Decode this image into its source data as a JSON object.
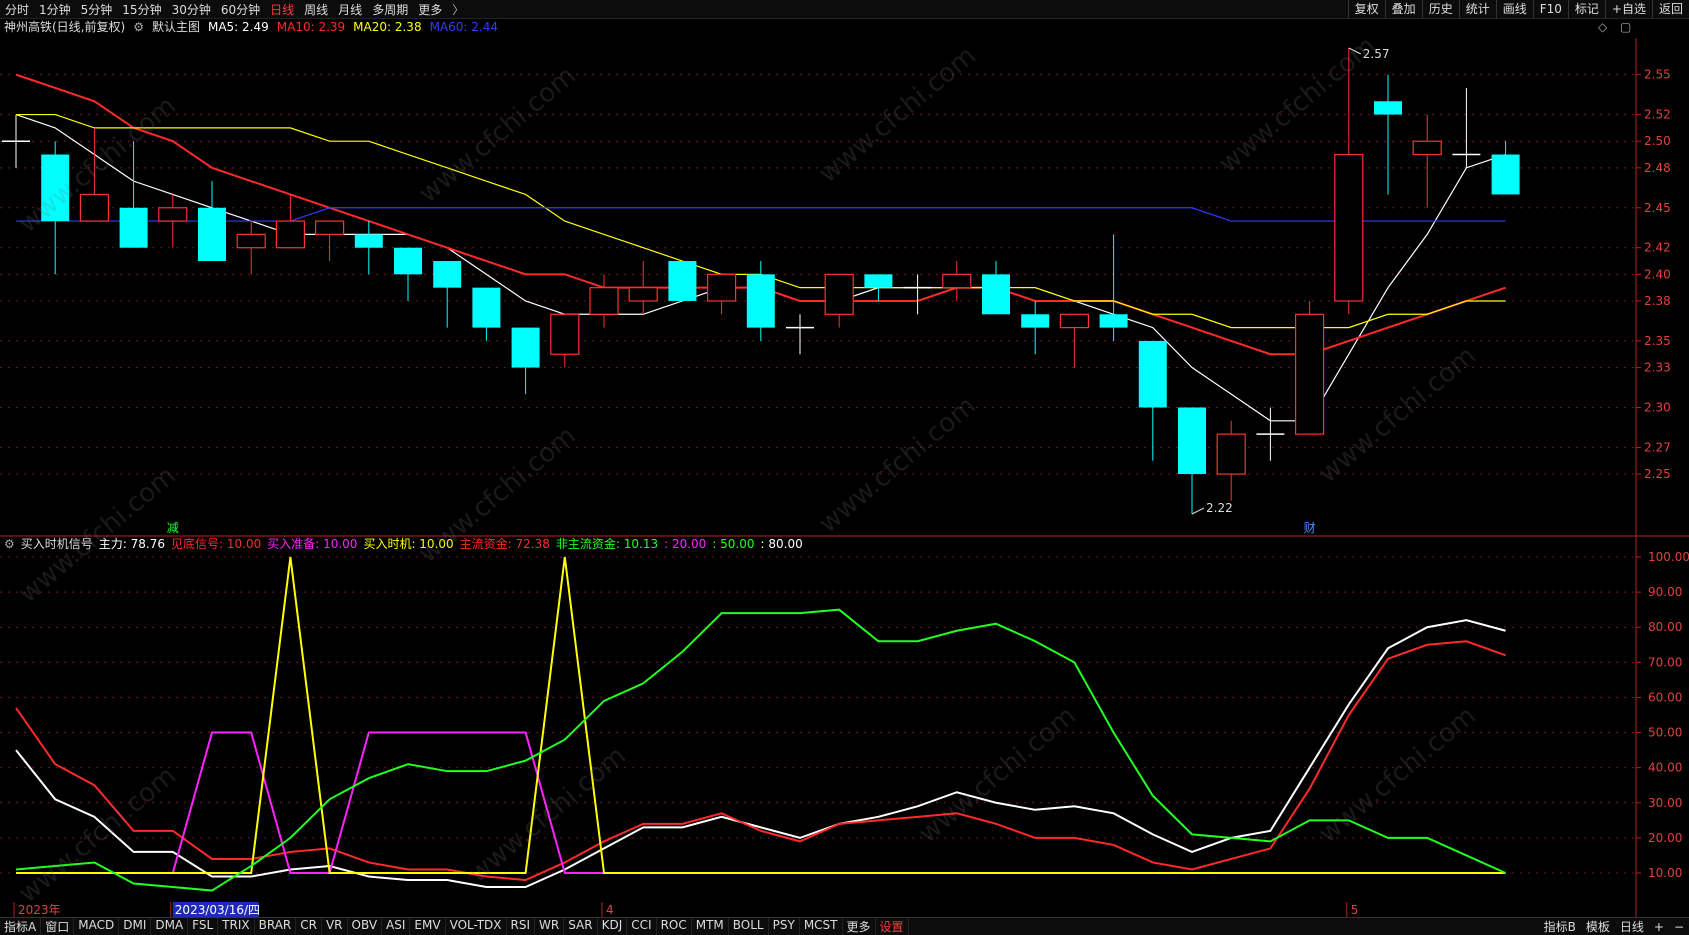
{
  "toolbar": {
    "timeframes": [
      "分时",
      "1分钟",
      "5分钟",
      "15分钟",
      "30分钟",
      "60分钟",
      "日线",
      "周线",
      "月线",
      "多周期",
      "更多"
    ],
    "active_timeframe": "日线",
    "more_arrow": "〉",
    "right_buttons": [
      "复权",
      "叠加",
      "历史",
      "统计",
      "画线",
      "F10",
      "标记",
      "+自选",
      "返回"
    ]
  },
  "main_header": {
    "stock": "神州高铁(日线,前复权)",
    "template_icon": "gear-icon",
    "template": "默认主图",
    "ma_labels": [
      {
        "text": "MA5: 2.49",
        "color": "#ffffff"
      },
      {
        "text": "MA10: 2.39",
        "color": "#ff2a2a"
      },
      {
        "text": "MA20: 2.38",
        "color": "#ffff00"
      },
      {
        "text": "MA60: 2.44",
        "color": "#2f3cff"
      }
    ],
    "diamond_icon": "◇",
    "square_icon": "▢"
  },
  "sub_header": {
    "indicator": "买入时机信号",
    "labels": [
      {
        "text": "主力: 78.76",
        "color": "#ffffff"
      },
      {
        "text": "见底信号: 10.00",
        "color": "#ff2a2a"
      },
      {
        "text": "买入准备: 10.00",
        "color": "#ff22ff"
      },
      {
        "text": "买入时机: 10.00",
        "color": "#ffff00"
      },
      {
        "text": "主流资金: 72.38",
        "color": "#ff2a2a"
      },
      {
        "text": "非主流资金: 10.13",
        "color": "#22ff22"
      },
      {
        "text": ": 20.00",
        "color": "#ff22ff"
      },
      {
        "text": ": 50.00",
        "color": "#22ff22"
      },
      {
        "text": ": 80.00",
        "color": "#ffffff"
      }
    ]
  },
  "bottom_tabs": [
    "指标A",
    "窗口",
    "MACD",
    "DMI",
    "DMA",
    "FSL",
    "TRIX",
    "BRAR",
    "CR",
    "VR",
    "OBV",
    "ASI",
    "EMV",
    "VOL-TDX",
    "RSI",
    "WR",
    "SAR",
    "KDJ",
    "CCI",
    "ROC",
    "MTM",
    "BOLL",
    "PSY",
    "MCST",
    "更多",
    "设置"
  ],
  "bottom_active": "设置",
  "bottom_right": [
    "指标B",
    "模板",
    "日线",
    "+",
    "−"
  ],
  "watermark": "www.cfchi.com",
  "chart_data": [
    {
      "type": "candlestick",
      "name": "main",
      "ylim": [
        2.22,
        2.57
      ],
      "y_ticks": [
        2.25,
        2.27,
        2.3,
        2.33,
        2.35,
        2.38,
        2.4,
        2.42,
        2.45,
        2.48,
        2.5,
        2.52,
        2.55
      ],
      "candles": [
        {
          "o": 2.5,
          "c": 2.5,
          "h": 2.52,
          "l": 2.48
        },
        {
          "o": 2.49,
          "c": 2.44,
          "h": 2.5,
          "l": 2.4
        },
        {
          "o": 2.44,
          "c": 2.46,
          "h": 2.51,
          "l": 2.44
        },
        {
          "o": 2.45,
          "c": 2.42,
          "h": 2.5,
          "l": 2.42
        },
        {
          "o": 2.44,
          "c": 2.45,
          "h": 2.46,
          "l": 2.42
        },
        {
          "o": 2.45,
          "c": 2.41,
          "h": 2.47,
          "l": 2.41
        },
        {
          "o": 2.42,
          "c": 2.43,
          "h": 2.44,
          "l": 2.4
        },
        {
          "o": 2.42,
          "c": 2.44,
          "h": 2.46,
          "l": 2.42
        },
        {
          "o": 2.43,
          "c": 2.44,
          "h": 2.44,
          "l": 2.41
        },
        {
          "o": 2.43,
          "c": 2.42,
          "h": 2.44,
          "l": 2.4
        },
        {
          "o": 2.42,
          "c": 2.4,
          "h": 2.42,
          "l": 2.38
        },
        {
          "o": 2.41,
          "c": 2.39,
          "h": 2.41,
          "l": 2.36
        },
        {
          "o": 2.39,
          "c": 2.36,
          "h": 2.39,
          "l": 2.35
        },
        {
          "o": 2.36,
          "c": 2.33,
          "h": 2.36,
          "l": 2.31
        },
        {
          "o": 2.34,
          "c": 2.37,
          "h": 2.37,
          "l": 2.33
        },
        {
          "o": 2.37,
          "c": 2.39,
          "h": 2.4,
          "l": 2.36
        },
        {
          "o": 2.38,
          "c": 2.39,
          "h": 2.41,
          "l": 2.37
        },
        {
          "o": 2.41,
          "c": 2.38,
          "h": 2.41,
          "l": 2.38
        },
        {
          "o": 2.38,
          "c": 2.4,
          "h": 2.4,
          "l": 2.37
        },
        {
          "o": 2.4,
          "c": 2.36,
          "h": 2.41,
          "l": 2.35
        },
        {
          "o": 2.36,
          "c": 2.36,
          "h": 2.37,
          "l": 2.34
        },
        {
          "o": 2.37,
          "c": 2.4,
          "h": 2.4,
          "l": 2.36
        },
        {
          "o": 2.4,
          "c": 2.39,
          "h": 2.4,
          "l": 2.38
        },
        {
          "o": 2.39,
          "c": 2.39,
          "h": 2.4,
          "l": 2.37
        },
        {
          "o": 2.39,
          "c": 2.4,
          "h": 2.41,
          "l": 2.38
        },
        {
          "o": 2.4,
          "c": 2.37,
          "h": 2.41,
          "l": 2.37
        },
        {
          "o": 2.37,
          "c": 2.36,
          "h": 2.38,
          "l": 2.34
        },
        {
          "o": 2.36,
          "c": 2.37,
          "h": 2.37,
          "l": 2.33
        },
        {
          "o": 2.37,
          "c": 2.36,
          "h": 2.43,
          "l": 2.35
        },
        {
          "o": 2.35,
          "c": 2.3,
          "h": 2.35,
          "l": 2.26
        },
        {
          "o": 2.3,
          "c": 2.25,
          "h": 2.3,
          "l": 2.22
        },
        {
          "o": 2.25,
          "c": 2.28,
          "h": 2.29,
          "l": 2.23
        },
        {
          "o": 2.28,
          "c": 2.28,
          "h": 2.3,
          "l": 2.26
        },
        {
          "o": 2.28,
          "c": 2.37,
          "h": 2.38,
          "l": 2.28
        },
        {
          "o": 2.38,
          "c": 2.49,
          "h": 2.57,
          "l": 2.37
        },
        {
          "o": 2.53,
          "c": 2.52,
          "h": 2.55,
          "l": 2.46
        },
        {
          "o": 2.49,
          "c": 2.5,
          "h": 2.52,
          "l": 2.45
        },
        {
          "o": 2.49,
          "c": 2.49,
          "h": 2.54,
          "l": 2.48
        },
        {
          "o": 2.49,
          "c": 2.46,
          "h": 2.5,
          "l": 2.46
        }
      ],
      "ma_series": [
        {
          "name": "MA5",
          "color": "#ffffff",
          "values": [
            2.52,
            2.51,
            2.49,
            2.47,
            2.46,
            2.45,
            2.44,
            2.43,
            2.43,
            2.43,
            2.43,
            2.42,
            2.4,
            2.38,
            2.37,
            2.37,
            2.37,
            2.38,
            2.39,
            2.39,
            2.38,
            2.38,
            2.39,
            2.39,
            2.39,
            2.39,
            2.38,
            2.38,
            2.37,
            2.36,
            2.33,
            2.31,
            2.29,
            2.29,
            2.34,
            2.39,
            2.43,
            2.48,
            2.49
          ]
        },
        {
          "name": "MA10",
          "color": "#ff2a2a",
          "values": [
            2.55,
            2.54,
            2.53,
            2.51,
            2.5,
            2.48,
            2.47,
            2.46,
            2.45,
            2.44,
            2.43,
            2.42,
            2.41,
            2.4,
            2.4,
            2.39,
            2.39,
            2.39,
            2.39,
            2.39,
            2.38,
            2.38,
            2.38,
            2.38,
            2.39,
            2.39,
            2.38,
            2.38,
            2.38,
            2.37,
            2.36,
            2.35,
            2.34,
            2.34,
            2.35,
            2.36,
            2.37,
            2.38,
            2.39
          ]
        },
        {
          "name": "MA20",
          "color": "#ffff00",
          "values": [
            2.52,
            2.52,
            2.51,
            2.51,
            2.51,
            2.51,
            2.51,
            2.51,
            2.5,
            2.5,
            2.49,
            2.48,
            2.47,
            2.46,
            2.44,
            2.43,
            2.42,
            2.41,
            2.4,
            2.4,
            2.39,
            2.39,
            2.39,
            2.39,
            2.39,
            2.39,
            2.39,
            2.38,
            2.38,
            2.37,
            2.37,
            2.36,
            2.36,
            2.36,
            2.36,
            2.37,
            2.37,
            2.38,
            2.38
          ]
        },
        {
          "name": "MA60",
          "color": "#2f3cff",
          "values": [
            2.44,
            2.44,
            2.44,
            2.44,
            2.44,
            2.44,
            2.44,
            2.44,
            2.45,
            2.45,
            2.45,
            2.45,
            2.45,
            2.45,
            2.45,
            2.45,
            2.45,
            2.45,
            2.45,
            2.45,
            2.45,
            2.45,
            2.45,
            2.45,
            2.45,
            2.45,
            2.45,
            2.45,
            2.45,
            2.45,
            2.45,
            2.44,
            2.44,
            2.44,
            2.44,
            2.44,
            2.44,
            2.44,
            2.44
          ]
        }
      ],
      "annotations": [
        {
          "text": "2.57",
          "index": 34,
          "value": 2.57
        },
        {
          "text": "2.22",
          "index": 30,
          "value": 2.22
        }
      ],
      "markers": [
        {
          "text": "减",
          "index": 4,
          "color": "#22ff22"
        },
        {
          "text": "财",
          "index": 33,
          "color": "#4a90ff"
        }
      ]
    },
    {
      "type": "line",
      "name": "sub",
      "ylim": [
        10,
        100
      ],
      "y_ticks": [
        10,
        20,
        30,
        40,
        50,
        60,
        70,
        80,
        90,
        100
      ],
      "x_labels": [
        {
          "text": "2023年",
          "index": 0
        },
        {
          "text": "2023/03/16/四",
          "index": 4
        },
        {
          "text": "4",
          "index": 15
        },
        {
          "text": "5",
          "index": 34
        }
      ],
      "series": [
        {
          "name": "主力",
          "color": "#ffffff",
          "values": [
            45,
            31,
            26,
            16,
            16,
            9,
            9,
            11,
            12,
            9,
            8,
            8,
            6,
            6,
            11,
            17,
            23,
            23,
            26,
            23,
            20,
            24,
            26,
            29,
            33,
            30,
            28,
            29,
            27,
            21,
            16,
            20,
            22,
            40,
            58,
            74,
            80,
            82,
            79
          ]
        },
        {
          "name": "见底信号",
          "color": "#ff2a2a",
          "values": [
            57,
            41,
            35,
            22,
            22,
            14,
            14,
            16,
            17,
            13,
            11,
            11,
            9,
            8,
            13,
            19,
            24,
            24,
            27,
            22,
            19,
            24,
            25,
            26,
            27,
            24,
            20,
            20,
            18,
            13,
            11,
            14,
            17,
            34,
            55,
            71,
            75,
            76,
            72
          ]
        },
        {
          "name": "买入准备",
          "color": "#ff22ff",
          "values": [
            10,
            10,
            10,
            10,
            10,
            50,
            50,
            10,
            10,
            50,
            50,
            50,
            50,
            50,
            10,
            10,
            10,
            10,
            10,
            10,
            10,
            10,
            10,
            10,
            10,
            10,
            10,
            10,
            10,
            10,
            10,
            10,
            10,
            10,
            10,
            10,
            10,
            10,
            10
          ]
        },
        {
          "name": "买入时机",
          "color": "#ffff00",
          "values": [
            10,
            10,
            10,
            10,
            10,
            10,
            10,
            100,
            10,
            10,
            10,
            10,
            10,
            10,
            100,
            10,
            10,
            10,
            10,
            10,
            10,
            10,
            10,
            10,
            10,
            10,
            10,
            10,
            10,
            10,
            10,
            10,
            10,
            10,
            10,
            10,
            10,
            10,
            10
          ]
        },
        {
          "name": "非主流资金",
          "color": "#22ff22",
          "values": [
            11,
            12,
            13,
            7,
            6,
            5,
            12,
            20,
            31,
            37,
            41,
            39,
            39,
            42,
            48,
            59,
            64,
            73,
            84,
            84,
            84,
            85,
            76,
            76,
            79,
            81,
            76,
            70,
            50,
            32,
            21,
            20,
            19,
            25,
            25,
            20,
            20,
            15,
            10
          ]
        }
      ]
    }
  ]
}
